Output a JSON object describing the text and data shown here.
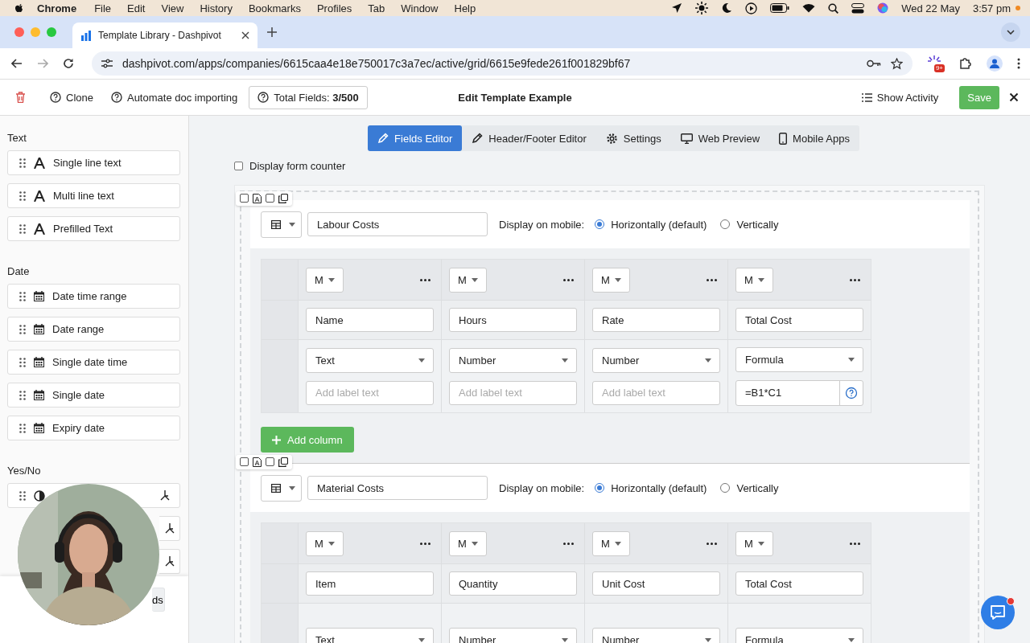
{
  "menubar": {
    "app": "Chrome",
    "items": [
      "File",
      "Edit",
      "View",
      "History",
      "Bookmarks",
      "Profiles",
      "Tab",
      "Window",
      "Help"
    ],
    "date": "Wed 22 May",
    "time": "3:57 pm"
  },
  "browser": {
    "tab_title": "Template Library - Dashpivot",
    "url": "dashpivot.com/apps/companies/6615caa4e18e750017c3a7ec/active/grid/6615e9fede261f001829bf67",
    "extension_badge": "9+"
  },
  "toolbar": {
    "clone": "Clone",
    "automate": "Automate doc importing",
    "total_fields": "Total Fields: **3/500**",
    "title": "Edit Template Example",
    "show_activity": "Show Activity",
    "save": "Save"
  },
  "sidebar": {
    "groups": [
      {
        "title": "Text",
        "items": [
          {
            "kind": "text",
            "label": "Single line text"
          },
          {
            "kind": "text",
            "label": "Multi line text"
          },
          {
            "kind": "text",
            "label": "Prefilled Text"
          }
        ]
      },
      {
        "title": "Date",
        "items": [
          {
            "kind": "date",
            "label": "Date time range"
          },
          {
            "kind": "date",
            "label": "Date range"
          },
          {
            "kind": "date",
            "label": "Single date time"
          },
          {
            "kind": "date",
            "label": "Single date"
          },
          {
            "kind": "date",
            "label": "Expiry date"
          }
        ]
      },
      {
        "title": "Yes/No",
        "items": [
          {
            "kind": "yesno"
          },
          {
            "kind": "covered"
          },
          {
            "kind": "covered"
          }
        ]
      }
    ],
    "footer_button": "ds"
  },
  "editor_tabs": [
    {
      "kind": "pencil",
      "label": "Fields Editor",
      "selected": true
    },
    {
      "kind": "pencil",
      "label": "Header/Footer Editor",
      "selected": false
    },
    {
      "kind": "gear",
      "label": "Settings",
      "selected": false
    },
    {
      "kind": "monitor",
      "label": "Web Preview",
      "selected": false
    },
    {
      "kind": "phone",
      "label": "Mobile Apps",
      "selected": false
    }
  ],
  "display_form_counter": {
    "label": "Display form counter",
    "checked": false
  },
  "sections": [
    {
      "title": "Labour Costs",
      "mobile_label": "Display on mobile:",
      "options": [
        {
          "label": "Horizontally (default)",
          "selected": true
        },
        {
          "label": "Vertically",
          "selected": false
        }
      ],
      "columns": [
        {
          "size": "M",
          "name": "Name",
          "type": "Text",
          "label": {
            "placeholder": "Add label text"
          }
        },
        {
          "size": "M",
          "name": "Hours",
          "type": "Number",
          "label": {
            "placeholder": "Add label text"
          }
        },
        {
          "size": "M",
          "name": "Rate",
          "type": "Number",
          "label": {
            "placeholder": "Add label text"
          }
        },
        {
          "size": "M",
          "name": "Total Cost",
          "type": "Formula",
          "label": {
            "value": "=B1*C1",
            "help": true
          }
        }
      ],
      "add_column": "Add column"
    },
    {
      "title": "Material Costs",
      "mobile_label": "Display on mobile:",
      "options": [
        {
          "label": "Horizontally (default)",
          "selected": true
        },
        {
          "label": "Vertically",
          "selected": false
        }
      ],
      "columns": [
        {
          "size": "M",
          "name": "Item",
          "type": "Text"
        },
        {
          "size": "M",
          "name": "Quantity",
          "type": "Number"
        },
        {
          "size": "M",
          "name": "Unit Cost",
          "type": "Number"
        },
        {
          "size": "M",
          "name": "Total Cost",
          "type": "Formula"
        }
      ]
    }
  ]
}
